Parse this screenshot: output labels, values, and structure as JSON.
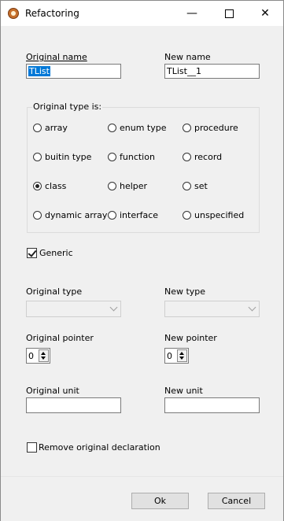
{
  "window": {
    "title": "Refactoring"
  },
  "titlebar": {
    "minimize": "—",
    "close": "✕"
  },
  "fields": {
    "original_name_label": "Original name",
    "original_name_value": "TList",
    "new_name_label": "New name",
    "new_name_value": "TList__1"
  },
  "type_group": {
    "title": "Original type is:",
    "options": [
      {
        "label": "array",
        "checked": false
      },
      {
        "label": "enum type",
        "checked": false
      },
      {
        "label": "procedure",
        "checked": false
      },
      {
        "label": "buitin type",
        "checked": false
      },
      {
        "label": "function",
        "checked": false
      },
      {
        "label": "record",
        "checked": false
      },
      {
        "label": "class",
        "checked": true
      },
      {
        "label": "helper",
        "checked": false
      },
      {
        "label": "set",
        "checked": false
      },
      {
        "label": "dynamic array",
        "checked": false
      },
      {
        "label": "interface",
        "checked": false
      },
      {
        "label": "unspecified",
        "checked": false
      }
    ]
  },
  "generic": {
    "label": "Generic",
    "checked": true
  },
  "types": {
    "original_type_label": "Original type",
    "original_type_value": "",
    "new_type_label": "New type",
    "new_type_value": ""
  },
  "pointers": {
    "original_pointer_label": "Original pointer",
    "original_pointer_value": "0",
    "new_pointer_label": "New pointer",
    "new_pointer_value": "0"
  },
  "units": {
    "original_unit_label": "Original unit",
    "original_unit_value": "",
    "new_unit_label": "New unit",
    "new_unit_value": ""
  },
  "remove_decl": {
    "label": "Remove original declaration",
    "checked": false
  },
  "buttons": {
    "ok": "Ok",
    "cancel": "Cancel"
  }
}
